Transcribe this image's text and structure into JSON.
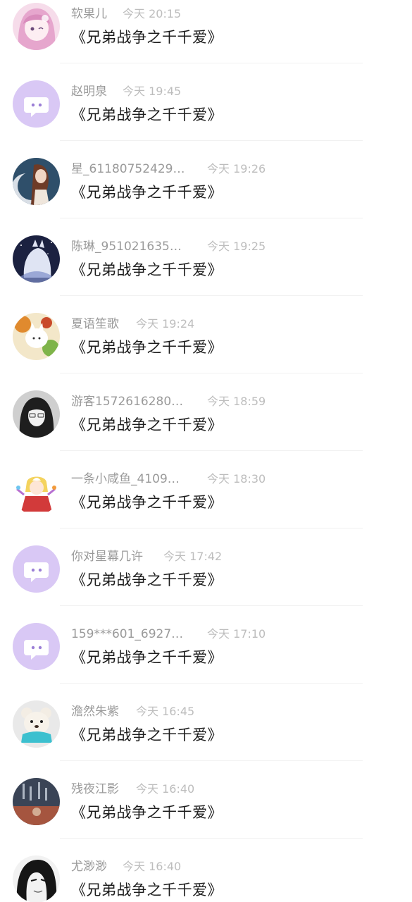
{
  "items": [
    {
      "user": "软果儿",
      "time": "今天 20:15",
      "message": "《兄弟战争之千千爱》",
      "avatar": "pink-anime-girl-avatar"
    },
    {
      "user": "赵明泉",
      "time": "今天 19:45",
      "message": "《兄弟战争之千千爱》",
      "avatar": "default-chat-avatar"
    },
    {
      "user": "星_61180752429…",
      "time": "今天 19:26",
      "message": "《兄弟战争之千千爱》",
      "avatar": "moon-girl-avatar"
    },
    {
      "user": "陈琳_951021635…",
      "time": "今天 19:25",
      "message": "《兄弟战争之千千爱》",
      "avatar": "white-wolf-avatar"
    },
    {
      "user": "夏语笙歌",
      "time": "今天 19:24",
      "message": "《兄弟战争之千千爱》",
      "avatar": "autumn-fox-avatar"
    },
    {
      "user": "游客1572616280…",
      "time": "今天 18:59",
      "message": "《兄弟战争之千千爱》",
      "avatar": "dark-hair-girl-avatar"
    },
    {
      "user": "一条小咸鱼_4109…",
      "time": "今天 18:30",
      "message": "《兄弟战争之千千爱》",
      "avatar": "flandre-anime-avatar"
    },
    {
      "user": "你对星幕几许",
      "time": "今天 17:42",
      "message": "《兄弟战争之千千爱》",
      "avatar": "default-chat-avatar"
    },
    {
      "user": "159***601_6927…",
      "time": "今天 17:10",
      "message": "《兄弟战争之千千爱》",
      "avatar": "default-chat-avatar"
    },
    {
      "user": "澹然朱紫",
      "time": "今天 16:45",
      "message": "《兄弟战争之千千爱》",
      "avatar": "teddy-bear-avatar"
    },
    {
      "user": "残夜江影",
      "time": "今天 16:40",
      "message": "《兄弟战争之千千爱》",
      "avatar": "dark-text-art-avatar"
    },
    {
      "user": "尤渺渺",
      "time": "今天 16:40",
      "message": "《兄弟战争之千千爱》",
      "avatar": "ink-portrait-avatar"
    }
  ],
  "colors": {
    "default_avatar_bg": "#d9c8f5",
    "default_avatar_fg": "#ffffff",
    "default_avatar_eye": "#9b7fd6"
  }
}
